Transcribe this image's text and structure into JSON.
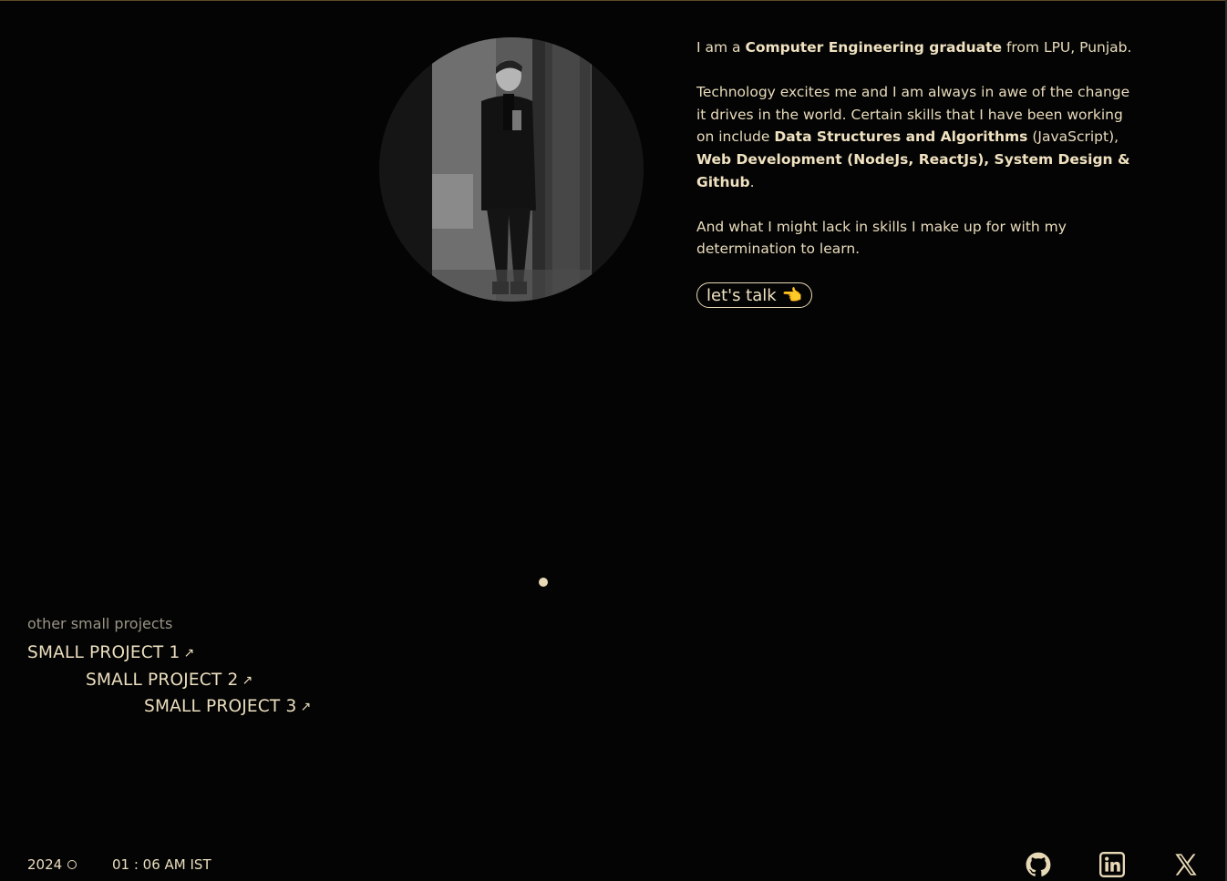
{
  "bio": {
    "p1_a": "I am a ",
    "p1_b": "Computer Engineering graduate",
    "p1_c": " from LPU, Punjab.",
    "p2_a": "Technology excites me and I am always in awe of the change it drives in the world. Certain skills that I have been working on include ",
    "p2_b": "Data Structures and Algorithms",
    "p2_c": " (JavaScript), ",
    "p2_d": "Web Development (NodeJs, ReactJs), System Design & Github",
    "p2_e": ".",
    "p3": "And what I might lack in skills I make up for with my determination to learn."
  },
  "cta": {
    "label": "let's talk",
    "emoji": "👈"
  },
  "projects": {
    "heading": "other small projects",
    "items": [
      {
        "label": "SMALL PROJECT 1",
        "arrow": "↗"
      },
      {
        "label": "SMALL PROJECT 2",
        "arrow": "↗"
      },
      {
        "label": "SMALL PROJECT 3",
        "arrow": "↗"
      }
    ]
  },
  "footer": {
    "year": "2024",
    "time": "01 : 06 AM IST",
    "social": [
      "github-icon",
      "linkedin-icon",
      "x-icon"
    ]
  },
  "colors": {
    "background": "#040404",
    "text": "#e8d9b6",
    "muted": "#9a9486"
  }
}
